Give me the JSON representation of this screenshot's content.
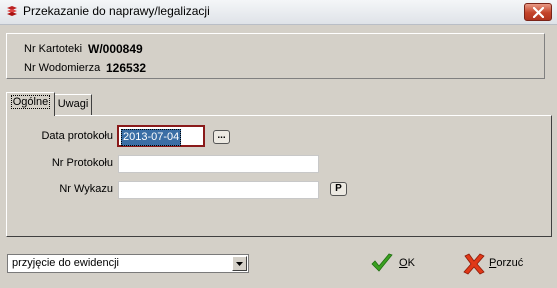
{
  "window": {
    "title": "Przekazanie do naprawy/legalizacji",
    "close_icon": "close-icon",
    "app_icon": "app-icon"
  },
  "info": {
    "kartoteka_label": "Nr Kartoteki",
    "kartoteka_value": "W/000849",
    "wodomierz_label": "Nr Wodomierza",
    "wodomierz_value": "126532"
  },
  "tabs": [
    {
      "label": "Ogólne",
      "active": true
    },
    {
      "label": "Uwagi",
      "active": false
    }
  ],
  "form": {
    "data_protokolu_label": "Data protokołu",
    "data_protokolu_value": "2013-07-04",
    "date_picker_label": "...",
    "nr_protokolu_label": "Nr Protokołu",
    "nr_protokolu_value": "",
    "nr_wykazu_label": "Nr Wykazu",
    "nr_wykazu_value": "",
    "p_button_label": "P"
  },
  "footer": {
    "combo_value": "przyjęcie do ewidencji",
    "ok_first": "O",
    "ok_rest": "K",
    "cancel_first": "P",
    "cancel_rest": "orzuć",
    "ok_icon": "checkmark-icon",
    "cancel_icon": "cross-icon"
  },
  "colors": {
    "dialog_bg": "#d4d0c8",
    "selection": "#3a6ea5",
    "focus_border": "#8a1a1a",
    "close_red": "#c4442a",
    "ok_green": "#3aa020",
    "cancel_red": "#e03818"
  }
}
